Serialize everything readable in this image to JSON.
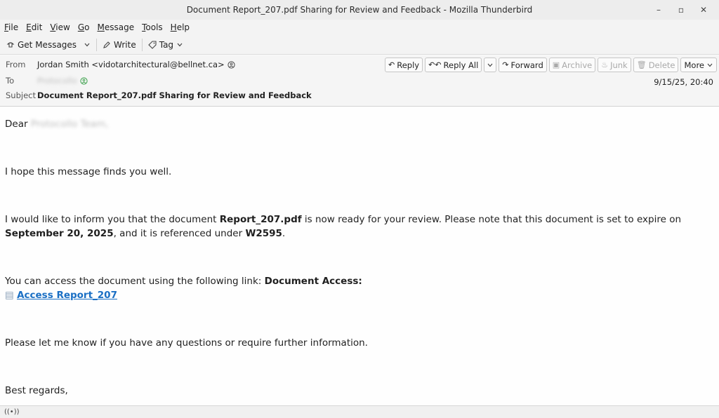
{
  "window": {
    "title": "Document Report_207.pdf Sharing for Review and Feedback - Mozilla Thunderbird",
    "controls": {
      "minimize": "–",
      "maximize": "▫",
      "close": "✕"
    }
  },
  "menu": {
    "items": [
      {
        "prefix": "",
        "key": "F",
        "rest": "ile"
      },
      {
        "prefix": "",
        "key": "E",
        "rest": "dit"
      },
      {
        "prefix": "",
        "key": "V",
        "rest": "iew"
      },
      {
        "prefix": "",
        "key": "G",
        "rest": "o"
      },
      {
        "prefix": "",
        "key": "M",
        "rest": "essage"
      },
      {
        "prefix": "",
        "key": "T",
        "rest": "ools"
      },
      {
        "prefix": "",
        "key": "H",
        "rest": "elp"
      }
    ]
  },
  "toolbar": {
    "get_messages": "Get Messages",
    "write": "Write",
    "tag": "Tag"
  },
  "header": {
    "from_label": "From",
    "from_value": "Jordan Smith <vidotarchitectural@bellnet.ca>",
    "to_label": "To",
    "to_value": "Protocollo",
    "subject_label": "Subject",
    "subject_value": "Document Report_207.pdf Sharing for Review and Feedback",
    "date": "9/15/25, 20:40",
    "actions": {
      "reply": "Reply",
      "reply_all": "Reply All",
      "forward": "Forward",
      "archive": "Archive",
      "junk": "Junk",
      "delete": "Delete",
      "more": "More"
    }
  },
  "body": {
    "greeting_prefix": "Dear",
    "greeting_name": "Protocollo Team,",
    "line1": "I hope this message finds you well.",
    "p2_a": "I would like to inform you that the document ",
    "p2_doc": "Report_207.pdf",
    "p2_b": " is now ready for your review. Please note that this document is set to expire on ",
    "p2_date": "September 20, 2025",
    "p2_c": ", and it is referenced under ",
    "p2_ref": "W2595",
    "p2_d": ".",
    "p3_a": "You can access the document using the following link: ",
    "p3_bold": "Document Access:",
    "link_text": "Access Report_207",
    "p4": "Please let me know if you have any questions or require further information.",
    "closing": "Best regards,"
  },
  "status": {
    "icon": "((•))"
  }
}
